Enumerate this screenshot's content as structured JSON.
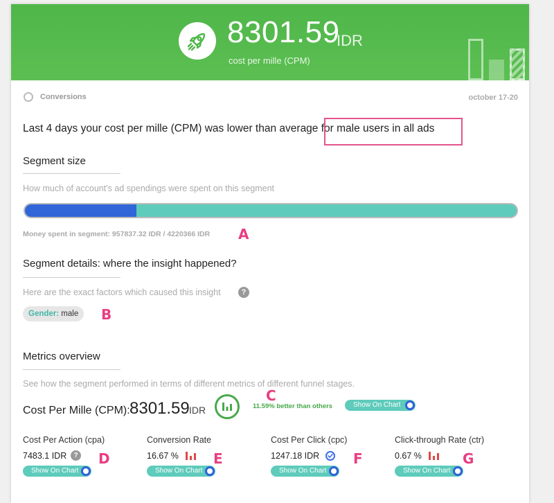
{
  "header": {
    "value": "8301.59",
    "unit": "IDR",
    "subtitle": "cost per mille (CPM)",
    "icon": "rocket-icon"
  },
  "meta": {
    "category": "Conversions",
    "date_range": "october 17-20"
  },
  "headline": {
    "prefix": "Last 4 days your cost per mille (CPM) was lower than average",
    "highlight": " for male users in all ads"
  },
  "segment_size": {
    "title": "Segment size",
    "description": "How much of account's ad spendings were spent on this segment",
    "fill_fraction": 0.227,
    "money_label": "Money spent in segment: 957837.32 IDR / 4220366 IDR"
  },
  "segment_details": {
    "title": "Segment details: where the insight happened?",
    "description": "Here are the exact factors which caused this insight",
    "chip_key": "Gender:",
    "chip_value": "male"
  },
  "metrics": {
    "title": "Metrics overview",
    "description": "See how the segment performed in terms of different metrics of different funnel stages.",
    "cpm": {
      "label": "Cost Per Mille (CPM):",
      "value": "8301.59",
      "unit": "IDR",
      "comparison": "11.59% better than others",
      "toggle": "Show On Chart"
    },
    "items": [
      {
        "label": "Cost Per Action (cpa)",
        "value": "7483.1 IDR",
        "toggle": "Show On Chart",
        "marker": "help-icon"
      },
      {
        "label": "Conversion Rate",
        "value": "16.67 %",
        "toggle": "Show On Chart",
        "marker": "bar-chart-icon"
      },
      {
        "label": "Cost Per Click (cpc)",
        "value": "1247.18 IDR",
        "toggle": "Show On Chart",
        "marker": "check-circle-icon"
      },
      {
        "label": "Click-through Rate (ctr)",
        "value": "0.67 %",
        "toggle": "Show On Chart",
        "marker": "bar-chart-icon"
      }
    ]
  },
  "annotations": [
    "A",
    "B",
    "C",
    "D",
    "E",
    "F",
    "G"
  ],
  "colors": {
    "header_green": "#5cbf52",
    "progress_fill": "#3066d8",
    "progress_track": "#5ecbbb",
    "highlight_box": "#e4538a",
    "annotation_letter": "#e83e83",
    "positive_green": "#47a94a",
    "negative_red": "#e04848"
  }
}
